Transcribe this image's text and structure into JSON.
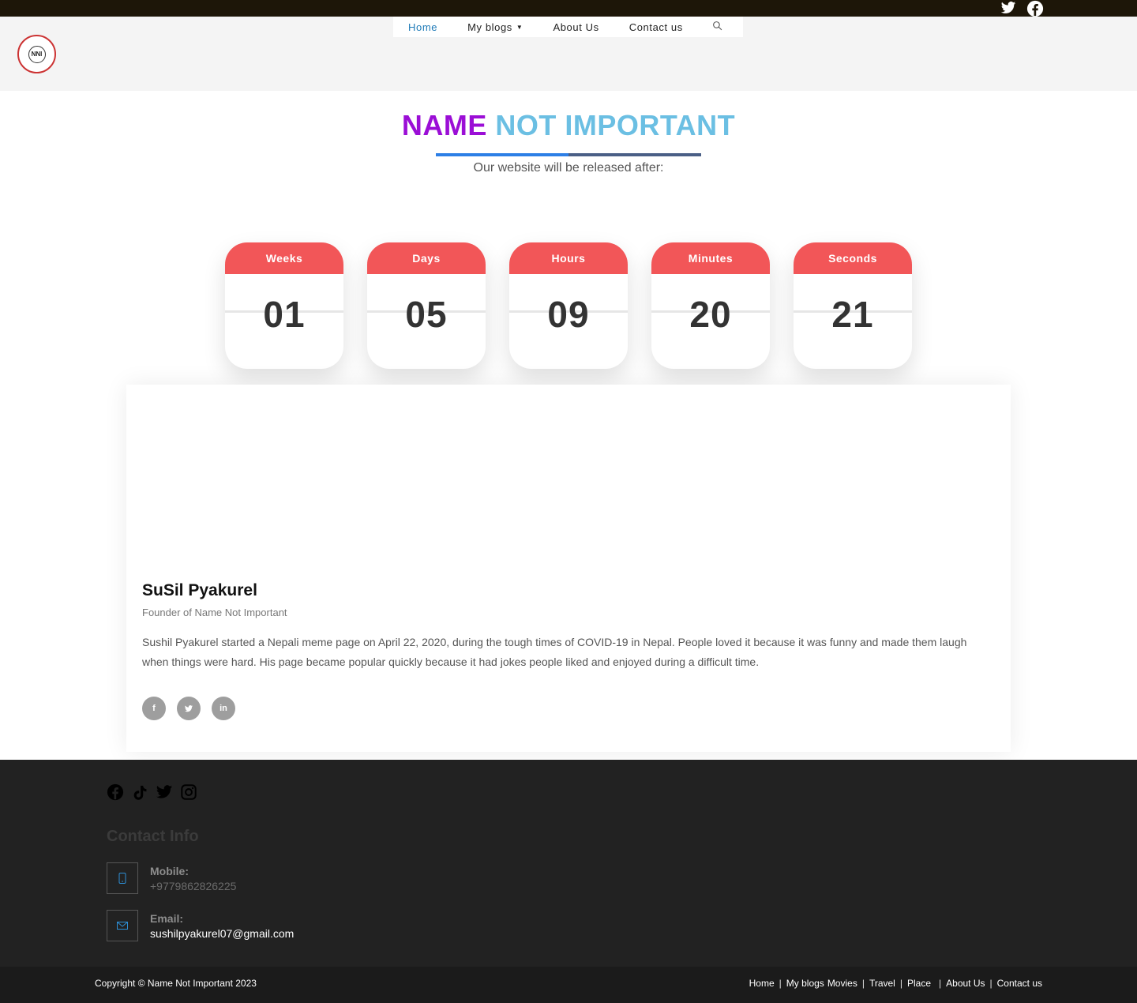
{
  "header": {
    "logo_text": "NNI",
    "nav": [
      {
        "label": "Home",
        "active": true
      },
      {
        "label": "My blogs",
        "has_dropdown": true
      },
      {
        "label": "About Us"
      },
      {
        "label": "Contact us"
      }
    ],
    "top_social_icons": [
      "twitter-icon",
      "facebook-icon"
    ]
  },
  "hero": {
    "title_part1": "NAME",
    "title_part2": "NOT IMPORTANT",
    "subtitle": "Our website will be released after:",
    "colors": {
      "title_part1": "#9b0ed6",
      "title_part2": "#6bbfe3",
      "card_header": "#f25658"
    }
  },
  "countdown": [
    {
      "label": "Weeks",
      "value": "01"
    },
    {
      "label": "Days",
      "value": "05"
    },
    {
      "label": "Hours",
      "value": "09"
    },
    {
      "label": "Minutes",
      "value": "20"
    },
    {
      "label": "Seconds",
      "value": "21"
    }
  ],
  "profile": {
    "name": "SuSil Pyakurel",
    "role": "Founder of Name Not Important",
    "bio": "Sushil Pyakurel started a Nepali meme page on April 22, 2020, during the tough times of COVID-19 in Nepal. People loved it because it was funny and made them laugh when things were hard. His page became popular quickly because it had jokes people liked and enjoyed during a difficult time.",
    "social_icons": [
      "facebook-icon",
      "twitter-icon",
      "linkedin-icon"
    ]
  },
  "footer": {
    "social_icons": [
      "facebook-icon",
      "tiktok-icon",
      "twitter-icon",
      "instagram-icon"
    ],
    "contact_title": "Contact Info",
    "mobile_label": "Mobile:",
    "mobile_value": "+9779862826225",
    "email_label": "Email:",
    "email_value": "sushilpyakurel07@gmail.com"
  },
  "bottom": {
    "copyright": "Copyright © Name Not Important 2023",
    "links": [
      "Home",
      "My blogs",
      "Movies",
      "Travel",
      "Place",
      "About Us",
      "Contact us"
    ]
  }
}
